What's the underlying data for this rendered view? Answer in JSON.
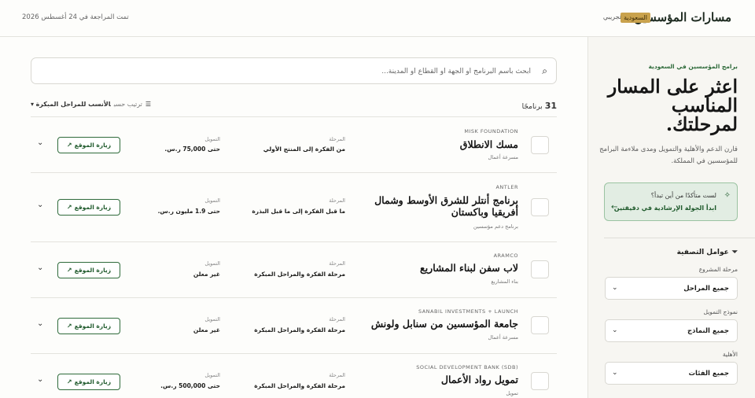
{
  "header": {
    "brand": "مسارات المؤسسين",
    "country_badge": "السعودية",
    "beta": "تجريبي",
    "reviewed": "تمت المراجعة في 24 أغسطس 2026"
  },
  "sidebar": {
    "eyebrow": "برامج المؤسسين في السعودية",
    "title": "اعثر على المسار المناسب لمرحلتك.",
    "description": "قارن الدعم والأهلية والتمويل ومدى ملاءمة البرامج للمؤسسين في المملكة.",
    "guide": {
      "question": "لست متأكدًا من أين تبدأ؟",
      "cta": "ابدأ الجولة الإرشادية في دقيقتين"
    },
    "filters_title": "عوامل التصفية",
    "filters": [
      {
        "label": "مرحلة المشروع",
        "value": "جميع المراحل"
      },
      {
        "label": "نموذج التمويل",
        "value": "جميع النماذج"
      },
      {
        "label": "الأهلية",
        "value": "جميع الفئات"
      }
    ]
  },
  "main": {
    "search_placeholder": "ابحث باسم البرنامج أو الجهة أو القطاع أو المدينة...",
    "count_number": "31",
    "count_label": "برنامجًا",
    "sort_label": "ترتيب حسب",
    "sort_value": "الأنسب للمراحل المبكرة",
    "stage_key": "المرحلة",
    "funding_key": "التمويل",
    "visit_label": "زيارة الموقع",
    "programs": [
      {
        "org": "MISK FOUNDATION",
        "name": "مسك الانطلاق",
        "type": "مسرعة أعمال",
        "stage": "من الفكرة إلى المنتج الأولي",
        "funding": "حتى 75,000 ر.س."
      },
      {
        "org": "ANTLER",
        "name": "برنامج أنتلر للشرق الأوسط وشمال أفريقيا وباكستان",
        "type": "برنامج دعم مؤسسين",
        "stage": "ما قبل الفكرة إلى ما قبل البذرة",
        "funding": "حتى 1.9 مليون ر.س."
      },
      {
        "org": "ARAMCO",
        "name": "لاب سفن لبناء المشاريع",
        "type": "بناء المشاريع",
        "stage": "مرحلة الفكرة والمراحل المبكرة",
        "funding": "غير معلن"
      },
      {
        "org": "SANABIL INVESTMENTS + LAUNCH",
        "name": "جامعة المؤسسين من سنابل ولونش",
        "type": "مسرعة أعمال",
        "stage": "مرحلة الفكرة والمراحل المبكرة",
        "funding": "غير معلن"
      },
      {
        "org": "SOCIAL DEVELOPMENT BANK (SDB)",
        "name": "تمويل رواد الأعمال",
        "type": "تمويل",
        "stage": "مرحلة الفكرة والمراحل المبكرة",
        "funding": "حتى 500,000 ر.س."
      }
    ]
  }
}
